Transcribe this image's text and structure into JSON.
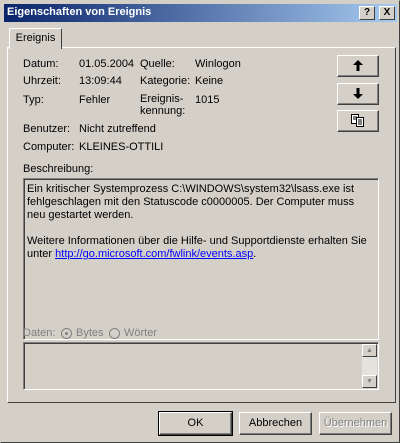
{
  "window": {
    "title": "Eigenschaften von Ereignis",
    "help_label": "?",
    "close_label": "X"
  },
  "tab": {
    "label": "Ereignis"
  },
  "event": {
    "date_label": "Datum:",
    "date": "01.05.2004",
    "time_label": "Uhrzeit:",
    "time": "13:09:44",
    "type_label": "Typ:",
    "type": "Fehler",
    "user_label": "Benutzer:",
    "user": "Nicht zutreffend",
    "computer_label": "Computer:",
    "computer": "KLEINES-OTTILI",
    "source_label": "Quelle:",
    "source": "Winlogon",
    "category_label": "Kategorie:",
    "category": "Keine",
    "eventid_label_line1": "Ereignis-",
    "eventid_label_line2": "kennung:",
    "eventid": "1015"
  },
  "nav": {
    "up_icon": "arrow-up-icon",
    "down_icon": "arrow-down-icon",
    "copy_icon": "copy-icon"
  },
  "description": {
    "label": "Beschreibung:",
    "para1": "Ein kritischer Systemprozess C:\\WINDOWS\\system32\\lsass.exe ist fehlgeschlagen mit den Statuscode c0000005. Der Computer muss neu gestartet werden.",
    "para2_prefix": "Weitere Informationen über die Hilfe- und Supportdienste erhalten Sie unter ",
    "link": "http://go.microsoft.com/fwlink/events.asp",
    "para2_suffix": "."
  },
  "data_section": {
    "label": "Daten:",
    "bytes_label": "Bytes",
    "words_label": "Wörter",
    "selected": "Bytes"
  },
  "buttons": {
    "ok": "OK",
    "cancel": "Abbrechen",
    "apply": "Übernehmen"
  }
}
